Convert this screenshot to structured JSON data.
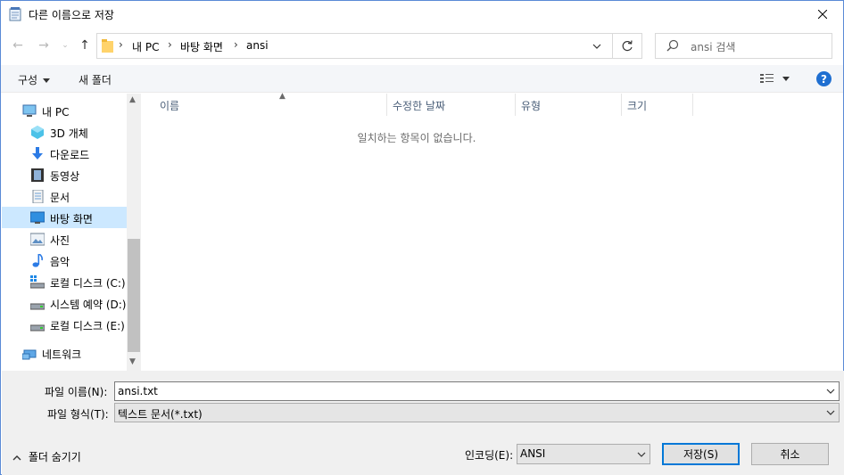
{
  "window": {
    "title": "다른 이름으로 저장",
    "close_icon": "close-icon"
  },
  "address": {
    "crumbs": [
      "내 PC",
      "바탕 화면",
      "ansi"
    ],
    "search_placeholder": "ansi 검색"
  },
  "toolbar": {
    "organize_label": "구성",
    "new_folder_label": "새 폴더",
    "help_label": "?"
  },
  "nav": {
    "items": [
      {
        "label": "내 PC",
        "icon": "pc-icon"
      },
      {
        "label": "3D 개체",
        "icon": "3d-objects-icon"
      },
      {
        "label": "다운로드",
        "icon": "download-icon"
      },
      {
        "label": "동영상",
        "icon": "video-icon"
      },
      {
        "label": "문서",
        "icon": "document-icon"
      },
      {
        "label": "바탕 화면",
        "icon": "desktop-icon",
        "selected": true
      },
      {
        "label": "사진",
        "icon": "pictures-icon"
      },
      {
        "label": "음악",
        "icon": "music-icon"
      },
      {
        "label": "로컬 디스크 (C:)",
        "icon": "drive-c-icon"
      },
      {
        "label": "시스템 예약 (D:)",
        "icon": "drive-d-icon"
      },
      {
        "label": "로컬 디스크 (E:)",
        "icon": "drive-e-icon"
      },
      {
        "label": "네트워크",
        "icon": "network-icon"
      }
    ]
  },
  "filelist": {
    "columns": [
      "이름",
      "수정한 날짜",
      "유형",
      "크기"
    ],
    "empty_message": "일치하는 항목이 없습니다."
  },
  "form": {
    "filename_label": "파일 이름(N):",
    "filename_label_key": "N",
    "filename_value": "ansi.txt",
    "filetype_label": "파일 형식(T):",
    "filetype_value": "텍스트 문서(*.txt)",
    "hide_folders_label": "폴더 숨기기",
    "encoding_label": "인코딩(E):",
    "encoding_value": "ANSI",
    "save_label": "저장(S)",
    "cancel_label": "취소"
  },
  "colors": {
    "accent": "#0078d7",
    "selection": "#cce8ff",
    "help": "#1f6fd1"
  }
}
